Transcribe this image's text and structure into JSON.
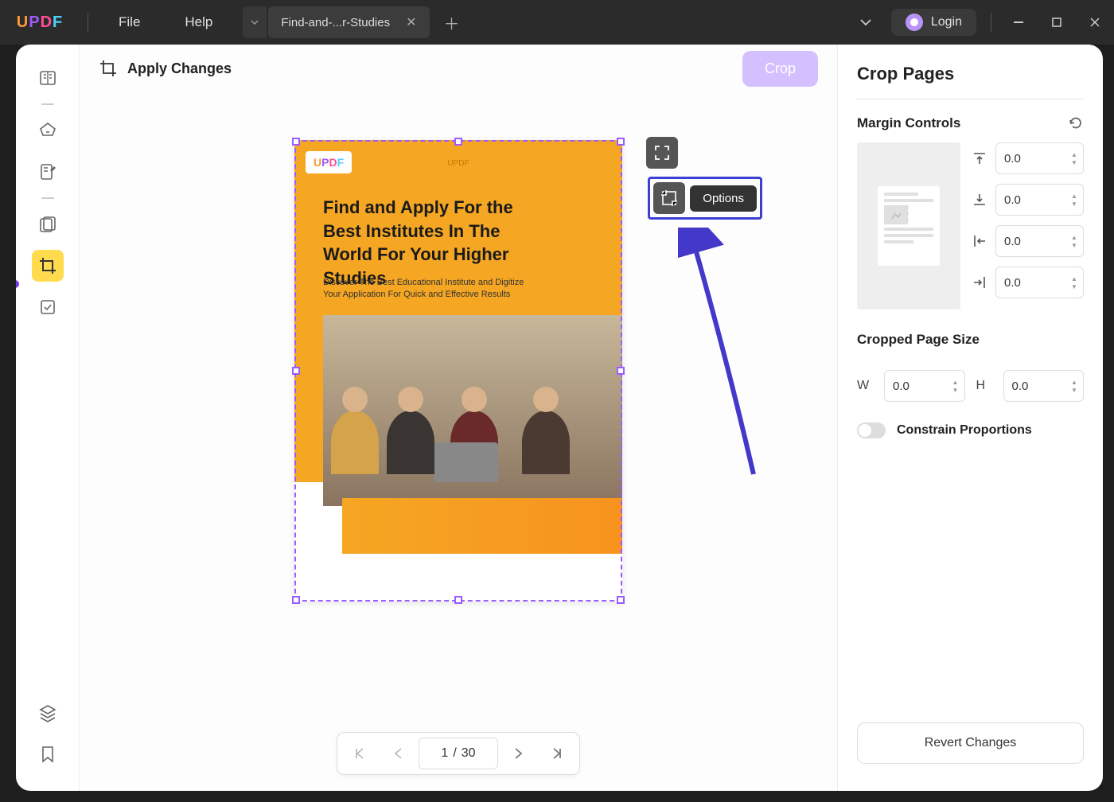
{
  "titlebar": {
    "logo": "UPDF",
    "menu": {
      "file": "File",
      "help": "Help"
    },
    "tab_label": "Find-and-...r-Studies",
    "login": "Login"
  },
  "toolbar": {
    "apply_label": "Apply Changes",
    "crop_label": "Crop",
    "options_tooltip": "Options"
  },
  "page_content": {
    "brand": "UPDF",
    "title": "Find and Apply For the Best Institutes In The World For Your Higher Studies",
    "subtitle": "Discover The Best Educational Institute and Digitize Your Application For Quick and Effective Results"
  },
  "page_nav": {
    "current": "1",
    "separator": "/",
    "total": "30"
  },
  "right_panel": {
    "title": "Crop Pages",
    "margin_controls": "Margin Controls",
    "margins": {
      "top": "0.0",
      "bottom": "0.0",
      "left": "0.0",
      "right": "0.0"
    },
    "cropped_size_title": "Cropped Page Size",
    "w_label": "W",
    "h_label": "H",
    "width": "0.0",
    "height": "0.0",
    "constrain": "Constrain Proportions",
    "revert": "Revert Changes"
  }
}
